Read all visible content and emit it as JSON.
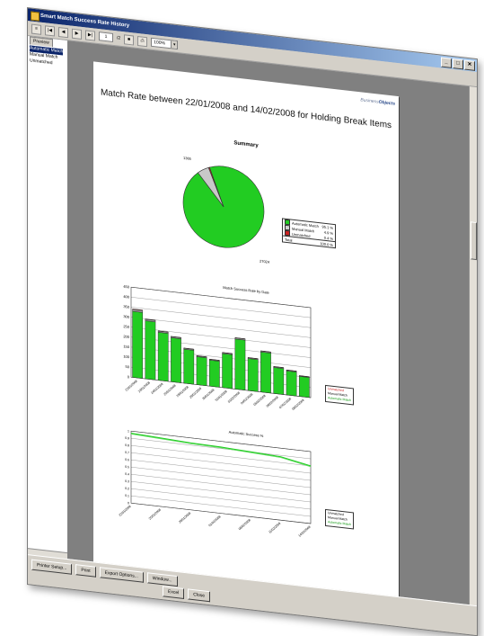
{
  "window": {
    "title": "Smart Match Success Rate History",
    "controls": [
      "_",
      "□",
      "✕"
    ]
  },
  "toolbar": {
    "page_number": "1",
    "page_total": "/2",
    "zoom": "100%"
  },
  "left_pane": {
    "tab": "Preview",
    "items": [
      "Automatic Match",
      "Manual Match",
      "Unmatched"
    ]
  },
  "report": {
    "logo_prefix": "Business",
    "logo_name": "Objects",
    "title": "Match Rate between 22/01/2008 and 14/02/2008 for Holding Break Items",
    "summary_title": "Summary",
    "pie_label_top": "1365",
    "pie_label_bottom": "27024",
    "legend": [
      {
        "label": "Automatic Match",
        "value": "95.1 %",
        "color": "#22cc22"
      },
      {
        "label": "Manual Match",
        "value": "4.9 %",
        "color": "#d0d0d0"
      },
      {
        "label": "Unmatched",
        "value": "0.4 %",
        "color": "#cc2222"
      },
      {
        "label": "Total",
        "value": "100.0 %",
        "color": ""
      }
    ],
    "bar_title": "Match Success Rate by Date",
    "line_title": "Automatic Success %",
    "bar_legend": [
      "Unmatched",
      "Manual Match",
      "Automatic Match"
    ],
    "line_legend": [
      "Unmatched",
      "Manual Match",
      "Automatic Match"
    ]
  },
  "chart_data": [
    {
      "type": "pie",
      "title": "Summary",
      "categories": [
        "Automatic Match",
        "Manual Match",
        "Unmatched"
      ],
      "values": [
        95.1,
        4.9,
        0.4
      ],
      "colors": [
        "#22cc22",
        "#c8c8c8",
        "#cc2222"
      ]
    },
    {
      "type": "bar",
      "title": "Match Success Rate by Date",
      "categories": [
        "22/01/2008",
        "23/01/2008",
        "24/01/2008",
        "25/01/2008",
        "28/01/2008",
        "29/01/2008",
        "30/01/2008",
        "31/01/2008",
        "01/02/2008",
        "04/02/2008",
        "05/02/2008",
        "06/02/2008",
        "07/02/2008",
        "08/02/2008"
      ],
      "series": [
        {
          "name": "Automatic Match",
          "values": [
            330,
            290,
            240,
            220,
            170,
            140,
            130,
            170,
            250,
            160,
            200,
            130,
            120,
            100
          ]
        },
        {
          "name": "Manual Match",
          "values": [
            10,
            8,
            6,
            6,
            5,
            4,
            4,
            5,
            6,
            4,
            5,
            4,
            4,
            3
          ]
        },
        {
          "name": "Unmatched",
          "values": [
            2,
            1,
            1,
            1,
            1,
            1,
            1,
            1,
            1,
            1,
            1,
            1,
            1,
            1
          ]
        }
      ],
      "ylim": [
        0,
        450
      ],
      "yticks": [
        0,
        50,
        100,
        150,
        200,
        250,
        300,
        350,
        400,
        450
      ]
    },
    {
      "type": "line",
      "title": "Automatic Success %",
      "x": [
        "22/01/2008",
        "25/01/2008",
        "29/01/2008",
        "01/02/2008",
        "06/02/2008",
        "11/02/2008",
        "14/02/2008"
      ],
      "series": [
        {
          "name": "Automatic Match",
          "values": [
            0.97,
            0.95,
            0.93,
            0.92,
            0.9,
            0.88,
            0.8
          ]
        },
        {
          "name": "Manual Match",
          "values": [
            0.96,
            0.94,
            0.92,
            0.91,
            0.89,
            0.87,
            0.79
          ]
        }
      ],
      "ylim": [
        0,
        1
      ],
      "yticks": [
        "0",
        "0.1",
        "0.2",
        "0.3",
        "0.4",
        "0.5",
        "0.6",
        "0.7",
        "0.8",
        "0.9",
        "1"
      ]
    }
  ],
  "buttons": {
    "row1": [
      "Printer Setup...",
      "Print",
      "Export Options...",
      "Window..."
    ],
    "row2": [
      "Excel",
      "Close"
    ]
  }
}
